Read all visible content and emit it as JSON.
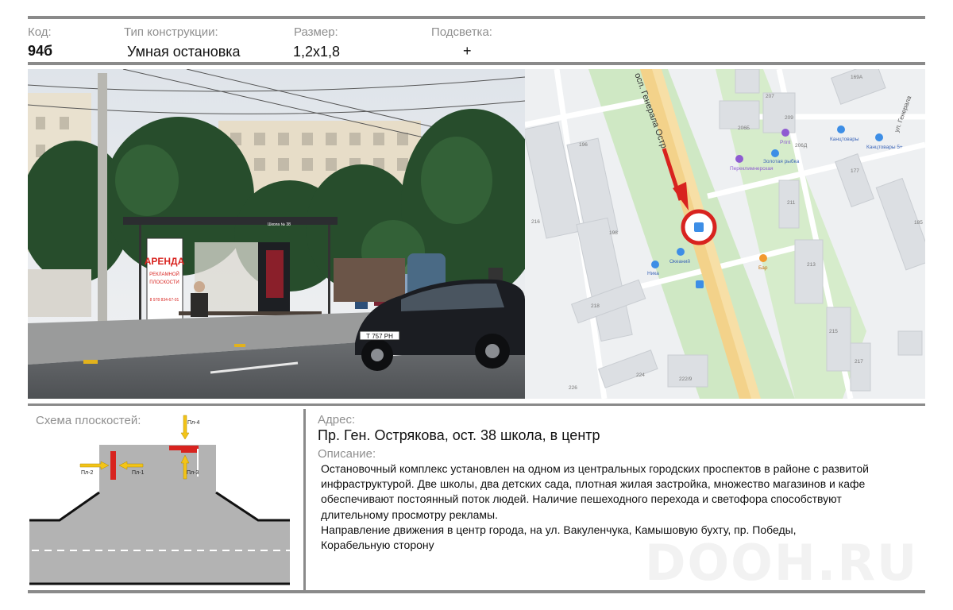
{
  "header": {
    "code_label": "Код:",
    "code_value": "94б",
    "type_label": "Тип конструкции:",
    "type_value": "Умная остановка",
    "size_label": "Размер:",
    "size_value": "1,2x1,8",
    "light_label": "Подсветка:",
    "light_value": "+"
  },
  "photo": {
    "billboard_line1": "АРЕНДА",
    "billboard_line2": "РЕКЛАМНОЙ",
    "billboard_line3": "ПЛОСКОСТИ",
    "billboard_phone": "8 978 834-67-01",
    "stop_sign": "Школа № 38",
    "car_plate": "Т 757 РН"
  },
  "map": {
    "street_main": "осп. Генерала Остр",
    "street_right": "ул. Генерала",
    "buildings": [
      "207",
      "209",
      "169А",
      "196",
      "206Б",
      "206Д",
      "177",
      "211",
      "185",
      "198",
      "213",
      "216",
      "218",
      "215",
      "217",
      "224",
      "222/9",
      "226"
    ],
    "pois": {
      "print": "Print",
      "fish": "Золотая рыбка",
      "perekhod": "Переклимнерская",
      "kanc1": "Канцтовары",
      "kanc2": "Канцтовары 5+",
      "okeaniy": "Океаний",
      "nika": "Ника",
      "bar": "Бар"
    }
  },
  "scheme": {
    "title": "Схема плоскостей:",
    "planes": [
      "Пл-1",
      "Пл-2",
      "Пл-3",
      "Пл-4"
    ]
  },
  "address": {
    "label": "Адрес:",
    "value": "Пр. Ген. Острякова,  ост. 38 школа, в центр"
  },
  "description": {
    "label": "Описание:",
    "line1": "Остановочный комплекс установлен на одном из центральных городских проспектов в районе с развитой",
    "line2": "инфраструктурой. Две школы, два детских сада, плотная жилая застройка, множество магазинов и кафе",
    "line3": "обеспечивают постоянный поток людей. Наличие пешеходного перехода и светофора способствуют",
    "line4": "длительному просмотру рекламы.",
    "line5": "Направление движения в центр города, на ул. Вакуленчука, Камышовую бухту, пр. Победы,",
    "line6": "Корабельную сторону"
  },
  "watermark": "DOOH.RU",
  "colors": {
    "rule": "#8a8a8a",
    "plane_red": "#d8231f",
    "arrow_yellow": "#f3c418",
    "map_road": "#f3d28a",
    "map_park": "#cfe8c4"
  }
}
